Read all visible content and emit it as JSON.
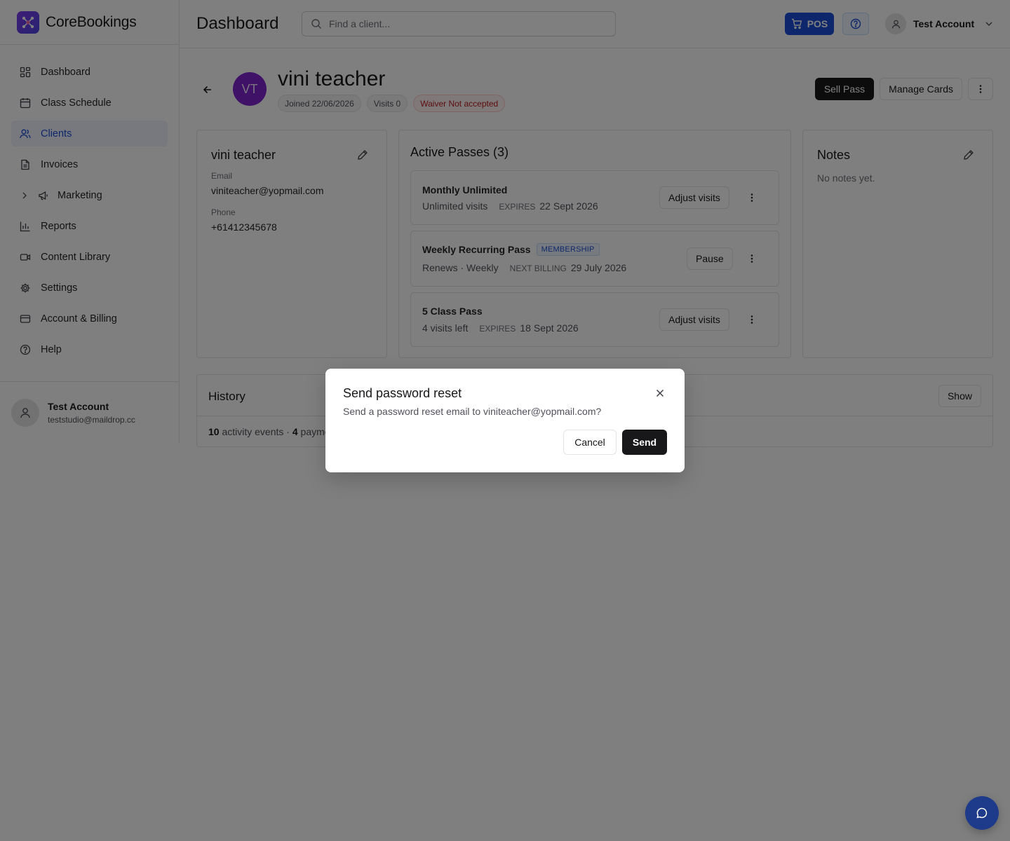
{
  "brand": {
    "name": "CoreBookings"
  },
  "header": {
    "title": "Dashboard",
    "search_placeholder": "Find a client...",
    "pos_label": "POS",
    "account_name": "Test Account"
  },
  "sidebar": {
    "items": [
      {
        "label": "Dashboard",
        "icon": "dashboard-icon"
      },
      {
        "label": "Class Schedule",
        "icon": "calendar-icon"
      },
      {
        "label": "Clients",
        "icon": "users-icon",
        "active": true
      },
      {
        "label": "Invoices",
        "icon": "file-icon"
      },
      {
        "label": "Marketing",
        "icon": "megaphone-icon",
        "expandable": true
      },
      {
        "label": "Reports",
        "icon": "bar-chart-icon"
      },
      {
        "label": "Content Library",
        "icon": "video-icon"
      },
      {
        "label": "Settings",
        "icon": "gear-icon"
      },
      {
        "label": "Account & Billing",
        "icon": "credit-card-icon"
      },
      {
        "label": "Help",
        "icon": "help-circle-icon"
      }
    ],
    "user": {
      "name": "Test Account",
      "email": "teststudio@maildrop.cc"
    }
  },
  "client": {
    "initials": "VT",
    "name": "vini teacher",
    "joined": "Joined 22/06/2026",
    "visits": "Visits 0",
    "waiver": "Waiver Not accepted",
    "actions": {
      "sell_pass": "Sell Pass",
      "manage_cards": "Manage Cards"
    }
  },
  "details_card": {
    "title": "vini teacher",
    "email_label": "Email",
    "email": "viniteacher@yopmail.com",
    "phone_label": "Phone",
    "phone": "+61412345678"
  },
  "passes_card": {
    "title": "Active Passes (3)",
    "passes": [
      {
        "name": "Monthly Unlimited",
        "badge": "",
        "meta": "Unlimited visits",
        "key": "EXPIRES",
        "value": "22 Sept 2026",
        "action": "Adjust visits"
      },
      {
        "name": "Weekly Recurring Pass",
        "badge": "MEMBERSHIP",
        "meta": "Renews · Weekly",
        "key": "NEXT BILLING",
        "value": "29 July 2026",
        "action": "Pause"
      },
      {
        "name": "5 Class Pass",
        "badge": "",
        "meta": "4 visits left",
        "key": "EXPIRES",
        "value": "18 Sept 2026",
        "action": "Adjust visits"
      }
    ]
  },
  "notes_card": {
    "title": "Notes",
    "empty": "No notes yet."
  },
  "history": {
    "title": "History",
    "show_label": "Show",
    "activity_count": "10",
    "activity_text": " activity events · ",
    "payment_count": "4",
    "payment_text": " payme"
  },
  "modal": {
    "title": "Send password reset",
    "description": "Send a password reset email to viniteacher@yopmail.com?",
    "cancel": "Cancel",
    "send": "Send"
  },
  "colors": {
    "accent": "#1d4ed8",
    "avatar": "#7e22ce",
    "overlay": "rgba(0,0,0,0.5)"
  }
}
